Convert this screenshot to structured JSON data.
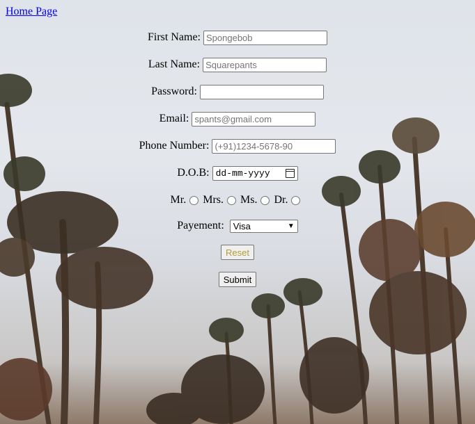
{
  "nav": {
    "home_link": "Home Page"
  },
  "form": {
    "first_name": {
      "label": "First Name:",
      "placeholder": "Spongebob"
    },
    "last_name": {
      "label": "Last Name:",
      "placeholder": "Squarepants"
    },
    "password": {
      "label": "Password:",
      "placeholder": ""
    },
    "email": {
      "label": "Email:",
      "placeholder": "spants@gmail.com"
    },
    "phone": {
      "label": "Phone Number:",
      "placeholder": "(+91)1234-5678-90"
    },
    "dob": {
      "label": "D.O.B:",
      "placeholder": "dd-mm-yyyy"
    },
    "titles": [
      "Mr.",
      "Mrs.",
      "Ms.",
      "Dr."
    ],
    "payment": {
      "label": "Payement:",
      "selected": "Visa"
    },
    "reset_label": "Reset",
    "submit_label": "Submit"
  },
  "colors": {
    "link": "#0000ee",
    "reset_text": "#b59c34"
  },
  "icons": {
    "calendar": "calendar-icon",
    "dropdown": "chevron-down-icon"
  }
}
